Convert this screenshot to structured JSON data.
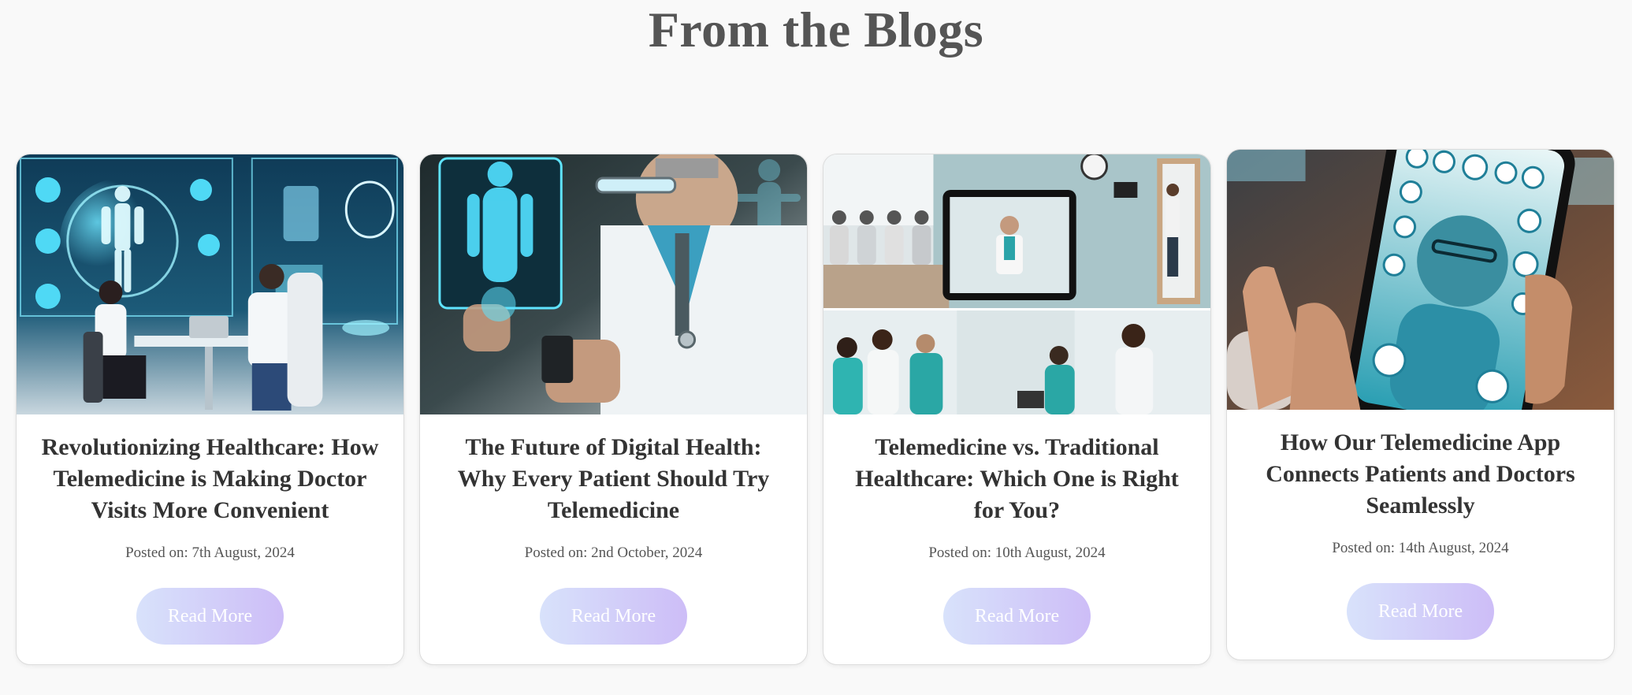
{
  "section": {
    "title": "From the Blogs"
  },
  "posts": [
    {
      "title": "Revolutionizing Healthcare: How Telemedicine is Making Doctor Visits More Convenient",
      "date": "Posted on: 7th August, 2024",
      "button_label": "Read More",
      "image_subject": "doctor-patient-holographic-consult"
    },
    {
      "title": "The Future of Digital Health: Why Every Patient Should Try Telemedicine",
      "date": "Posted on: 2nd October, 2024",
      "button_label": "Read More",
      "image_subject": "doctor-with-hologram-and-phone"
    },
    {
      "title": "Telemedicine vs. Traditional Healthcare: Which One is Right for You?",
      "date": "Posted on: 10th August, 2024",
      "button_label": "Read More",
      "image_subject": "waiting-room-and-tablet-collage"
    },
    {
      "title": "How Our Telemedicine App Connects Patients and Doctors Seamlessly",
      "date": "Posted on: 14th August, 2024",
      "button_label": "Read More",
      "image_subject": "hand-holding-phone-with-doctor"
    }
  ],
  "colors": {
    "background": "#f9f9f9",
    "title": "#555555",
    "button_gradient_start": "#d8e2fb",
    "button_gradient_end": "#cdbdf7"
  }
}
